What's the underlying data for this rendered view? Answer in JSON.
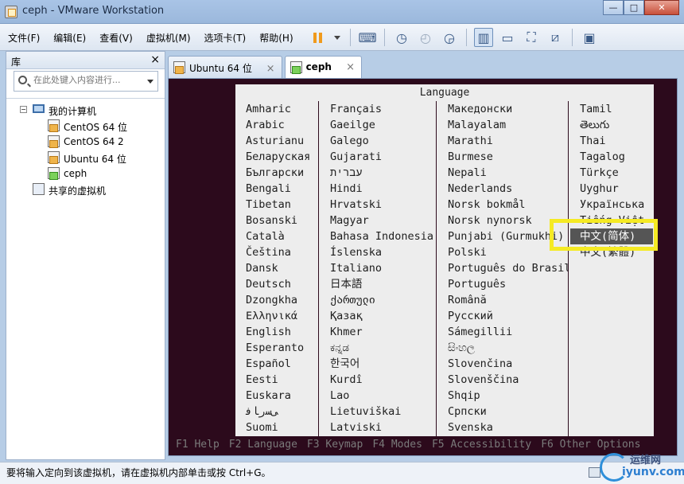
{
  "window": {
    "title": "ceph - VMware Workstation"
  },
  "menu": [
    "文件(F)",
    "编辑(E)",
    "查看(V)",
    "虚拟机(M)",
    "选项卡(T)",
    "帮助(H)"
  ],
  "toolbar": {
    "icons": [
      "pause-icon",
      "dropdown-icon",
      "send-ctrl-alt-del-icon",
      "snapshot-icon",
      "revert-snapshot-icon",
      "snapshot-manager-icon",
      "show-library-icon",
      "show-thumbnail-icon",
      "fullscreen-icon",
      "unity-icon",
      "console-view-icon"
    ]
  },
  "library": {
    "title": "库",
    "close": "×",
    "search_placeholder": "在此处键入内容进行...",
    "tree": {
      "root": "我的计算机",
      "vms": [
        "CentOS 64 位",
        "CentOS 64 2",
        "Ubuntu 64 位",
        "ceph"
      ],
      "shared": "共享的虚拟机"
    }
  },
  "tabs": [
    {
      "label": "Ubuntu 64 位",
      "close": "×"
    },
    {
      "label": "ceph",
      "close": "×"
    }
  ],
  "installer": {
    "header": "Language",
    "columns": [
      [
        "Amharic",
        "Arabic",
        "Asturianu",
        "Беларуская",
        "Български",
        "Bengali",
        "Tibetan",
        "Bosanski",
        "Català",
        "Čeština",
        "Dansk",
        "Deutsch",
        "Dzongkha",
        "Ελληνικά",
        "English",
        "Esperanto",
        "Español",
        "Eesti",
        "Euskara",
        "ﻰﺳﺭﺎﻓ",
        "Suomi"
      ],
      [
        "Français",
        "Gaeilge",
        "Galego",
        "Gujarati",
        "עברית",
        "Hindi",
        "Hrvatski",
        "Magyar",
        "Bahasa Indonesia",
        "Íslenska",
        "Italiano",
        "日本語",
        "ქართული",
        "Қазақ",
        "Khmer",
        "ಕನ್ನಡ",
        "한국어",
        "Kurdî",
        "Lao",
        "Lietuviškai",
        "Latviski"
      ],
      [
        "Македонски",
        "Malayalam",
        "Marathi",
        "Burmese",
        "Nepali",
        "Nederlands",
        "Norsk bokmål",
        "Norsk nynorsk",
        "Punjabi (Gurmukhi)",
        "Polski",
        "Português do Brasil",
        "Português",
        "Română",
        "Русский",
        "Sámegillii",
        "සිංහල",
        "Slovenčina",
        "Slovenščina",
        "Shqip",
        "Српски",
        "Svenska"
      ],
      [
        "Tamil",
        "తెలుగు",
        "Thai",
        "Tagalog",
        "Türkçe",
        "Uyghur",
        "Українська",
        "Tiếng Việt",
        "中文(简体)",
        "中文(繁體)"
      ]
    ],
    "selected": "中文(简体)",
    "fkeys": [
      "F1 Help",
      "F2 Language",
      "F3 Keymap",
      "F4 Modes",
      "F5 Accessibility",
      "F6 Other Options"
    ]
  },
  "status": {
    "message": "要将输入定向到该虚拟机，请在虚拟机内部单击或按 Ctrl+G。",
    "watermark_line1": "运维网",
    "watermark_line2": "iyunv.com"
  }
}
